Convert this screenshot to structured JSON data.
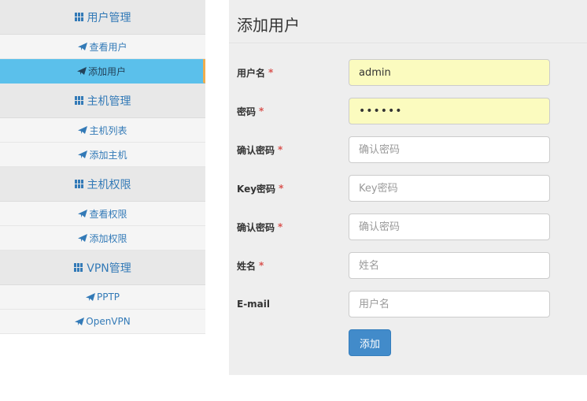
{
  "sidebar": {
    "sections": [
      {
        "header": "用户管理",
        "icon": "grid-icon",
        "items": [
          {
            "label": "查看用户",
            "icon": "paper-plane-icon"
          },
          {
            "label": "添加用户",
            "icon": "paper-plane-icon",
            "active": true
          }
        ]
      },
      {
        "header": "主机管理",
        "icon": "grid-icon",
        "items": [
          {
            "label": "主机列表",
            "icon": "paper-plane-icon"
          },
          {
            "label": "添加主机",
            "icon": "paper-plane-icon"
          }
        ]
      },
      {
        "header": "主机权限",
        "icon": "grid-icon",
        "items": [
          {
            "label": "查看权限",
            "icon": "paper-plane-icon"
          },
          {
            "label": "添加权限",
            "icon": "paper-plane-icon"
          }
        ]
      },
      {
        "header": "VPN管理",
        "icon": "grid-icon",
        "items": [
          {
            "label": "PPTP",
            "icon": "paper-plane-icon"
          },
          {
            "label": "OpenVPN",
            "icon": "paper-plane-icon"
          }
        ]
      }
    ]
  },
  "form": {
    "title": "添加用户",
    "required_mark": "*",
    "fields": [
      {
        "label": "用户名",
        "required": true,
        "value": "admin",
        "placeholder": ""
      },
      {
        "label": "密码",
        "required": true,
        "value": "••••••",
        "placeholder": "",
        "type": "password"
      },
      {
        "label": "确认密码",
        "required": true,
        "value": "",
        "placeholder": "确认密码"
      },
      {
        "label": "Key密码",
        "required": true,
        "value": "",
        "placeholder": "Key密码"
      },
      {
        "label": "确认密码",
        "required": true,
        "value": "",
        "placeholder": "确认密码"
      },
      {
        "label": "姓名",
        "required": true,
        "value": "",
        "placeholder": "姓名"
      },
      {
        "label": "E-mail",
        "required": false,
        "value": "",
        "placeholder": "用户名"
      }
    ],
    "submit_label": "添加"
  },
  "colors": {
    "link": "#337ab7",
    "active_bg": "#5bc0eb",
    "active_border": "#f0ad4e",
    "required": "#d9534f",
    "autofill_bg": "#fbfbbf",
    "button": "#428bca"
  }
}
